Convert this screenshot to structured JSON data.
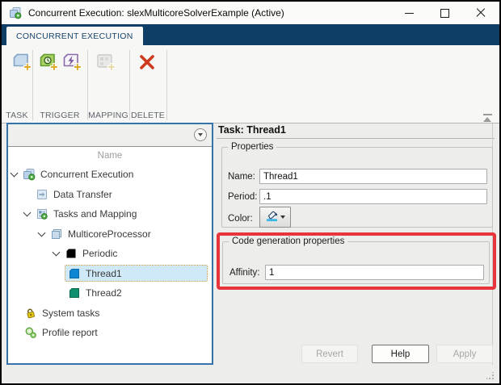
{
  "titlebar": {
    "title": "Concurrent Execution: slexMulticoreSolverExample (Active)"
  },
  "ribbon": {
    "tab_label": "CONCURRENT EXECUTION"
  },
  "toolbar": {
    "groups": [
      {
        "label": "TASK",
        "icons": [
          "task-add-icon"
        ]
      },
      {
        "label": "TRIGGER",
        "icons": [
          "trigger-clock-add-icon",
          "trigger-event-add-icon"
        ]
      },
      {
        "label": "MAPPING",
        "icons": [
          "mapping-add-icon"
        ],
        "disabled": true
      },
      {
        "label": "DELETE",
        "icons": [
          "delete-icon"
        ]
      }
    ]
  },
  "tree": {
    "column_header": "Name",
    "items": [
      {
        "label": "Concurrent Execution",
        "level": 0,
        "expanded": true,
        "icon": "concurrent-execution-icon"
      },
      {
        "label": "Data Transfer",
        "level": 1,
        "expanded": false,
        "icon": "data-transfer-icon",
        "slot": true
      },
      {
        "label": "Tasks and Mapping",
        "level": 1,
        "expanded": true,
        "icon": "tasks-mapping-icon"
      },
      {
        "label": "MulticoreProcessor",
        "level": 2,
        "expanded": true,
        "icon": "multicore-processor-icon"
      },
      {
        "label": "Periodic",
        "level": 3,
        "expanded": true,
        "icon": "periodic-icon"
      },
      {
        "label": "Thread1",
        "level": 4,
        "expanded": false,
        "icon": "thread-blue-icon",
        "slot": false,
        "selected": true
      },
      {
        "label": "Thread2",
        "level": 4,
        "expanded": false,
        "icon": "thread-green-icon",
        "slot": false
      },
      {
        "label": "System tasks",
        "level": 1,
        "expanded": false,
        "icon": "system-tasks-icon",
        "slot": false
      },
      {
        "label": "Profile report",
        "level": 1,
        "expanded": false,
        "icon": "profile-report-icon",
        "slot": false
      }
    ]
  },
  "panel": {
    "title": "Task: Thread1",
    "properties": {
      "legend": "Properties",
      "fields": [
        {
          "label": "Name:",
          "value": "Thread1"
        },
        {
          "label": "Period:",
          "value": ".1"
        },
        {
          "label": "Color:",
          "value": ""
        }
      ]
    },
    "codegen": {
      "legend": "Code generation properties",
      "fields": [
        {
          "label": "Affinity:",
          "value": "1"
        }
      ]
    },
    "buttons": [
      {
        "label": "Revert",
        "enabled": false
      },
      {
        "label": "Help",
        "enabled": true
      },
      {
        "label": "Apply",
        "enabled": false
      }
    ]
  },
  "colors": {
    "ribbon_navy": "#0e3e66",
    "tree_panel_border": "#3574ab",
    "selection_bg": "#cfe9f9",
    "selection_border": "#dd9f44",
    "annotation_red": "#e8343b",
    "thread1_blue": "#0a86d3",
    "thread2_green": "#0e8f6e"
  }
}
